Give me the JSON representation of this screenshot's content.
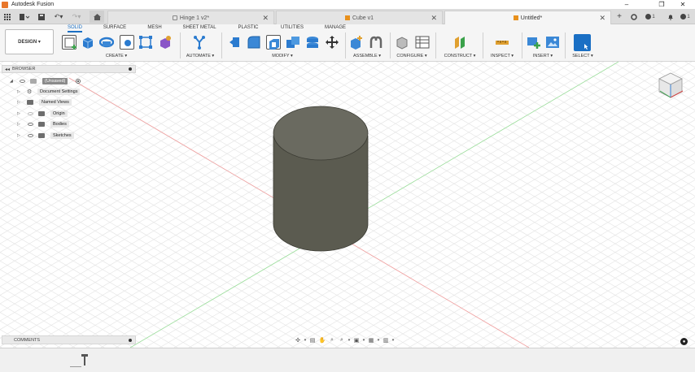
{
  "window": {
    "title": "Autodesk Fusion",
    "controls": [
      "–",
      "❐",
      "✕"
    ]
  },
  "tabbar": {
    "tabs": [
      {
        "label": "Hinge 1 v2*",
        "icon": "lock-icon",
        "active": false
      },
      {
        "label": "Cube v1",
        "icon": "cube-icon",
        "active": false
      },
      {
        "label": "Untitled*",
        "icon": "cube-icon",
        "active": true
      }
    ],
    "job_count": "1",
    "notification_count": "1"
  },
  "ribbon": {
    "workspace": "DESIGN ▾",
    "tabs": [
      "SOLID",
      "SURFACE",
      "MESH",
      "SHEET METAL",
      "PLASTIC",
      "UTILITIES",
      "MANAGE"
    ],
    "active_tab": "SOLID",
    "groups": [
      "CREATE ▾",
      "AUTOMATE ▾",
      "MODIFY ▾",
      "ASSEMBLE ▾",
      "CONFIGURE ▾",
      "CONSTRUCT ▾",
      "INSPECT ▾",
      "INSERT ▾",
      "SELECT ▾"
    ]
  },
  "browser": {
    "header": "BROWSER",
    "root": "(Unsaved)",
    "items": [
      "Document Settings",
      "Named Views",
      "Origin",
      "Bodies",
      "Sketches"
    ]
  },
  "comments": {
    "label": "COMMENTS"
  },
  "colors": {
    "accent": "#1a6fc4",
    "body_side": "#5b5b50",
    "body_top": "#6a6a60",
    "tab_icon": "#e8901c"
  }
}
